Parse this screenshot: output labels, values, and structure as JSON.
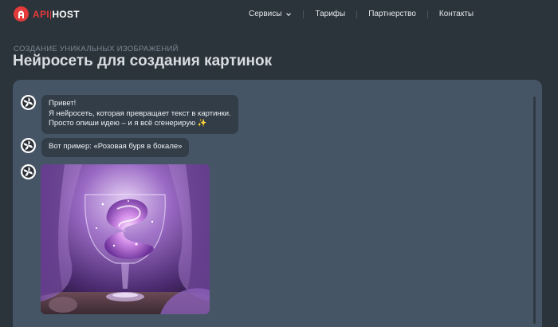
{
  "header": {
    "logo": {
      "api": "API",
      "host": "HOST"
    },
    "nav": [
      {
        "label": "Сервисы",
        "has_dropdown": true
      },
      {
        "label": "Тарифы"
      },
      {
        "label": "Партнерство"
      },
      {
        "label": "Контакты"
      }
    ]
  },
  "page": {
    "subtitle": "СОЗДАНИЕ УНИКАЛЬНЫХ ИЗОБРАЖЕНИЙ",
    "title": "Нейросеть для создания картинок"
  },
  "chat": {
    "messages": [
      {
        "lines": [
          "Привет!",
          "Я нейросеть, которая превращает текст в картинки.",
          "Просто опиши идею – и я всё сгенерирую ✨"
        ]
      },
      {
        "lines": [
          "Вот пример: «Розовая буря в бокале»"
        ]
      },
      {
        "image": "pink-storm-in-glass"
      }
    ]
  },
  "colors": {
    "accent": "#e33a3a",
    "page_bg": "#2b333b",
    "panel_bg": "#465566",
    "bubble_bg": "#323d48"
  }
}
